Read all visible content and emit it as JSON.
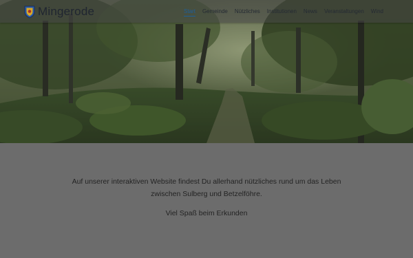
{
  "site": {
    "name": "Mingerode",
    "logo_icon": "coat-of-arms-icon"
  },
  "nav": {
    "active_color": "#1c5f9b",
    "items": [
      {
        "label": "Start",
        "active": true
      },
      {
        "label": "Gemeinde",
        "active": false
      },
      {
        "label": "Nützliches",
        "active": false
      },
      {
        "label": "Institutionen",
        "active": false
      },
      {
        "label": "News",
        "active": false
      },
      {
        "label": "Veranstaltungen",
        "active": false
      },
      {
        "label": "Wind",
        "active": false
      }
    ]
  },
  "hero": {
    "image": "forest-path-photo"
  },
  "intro": {
    "line1": "Auf unserer interaktiven Website findest Du allerhand nützliches rund um das Leben",
    "line2": "zwischen Sulberg und Betzelföhre.",
    "greeting": "Viel Spaß beim Erkunden"
  },
  "colors": {
    "page_background": "#6c6c6c",
    "text": "#232323"
  }
}
